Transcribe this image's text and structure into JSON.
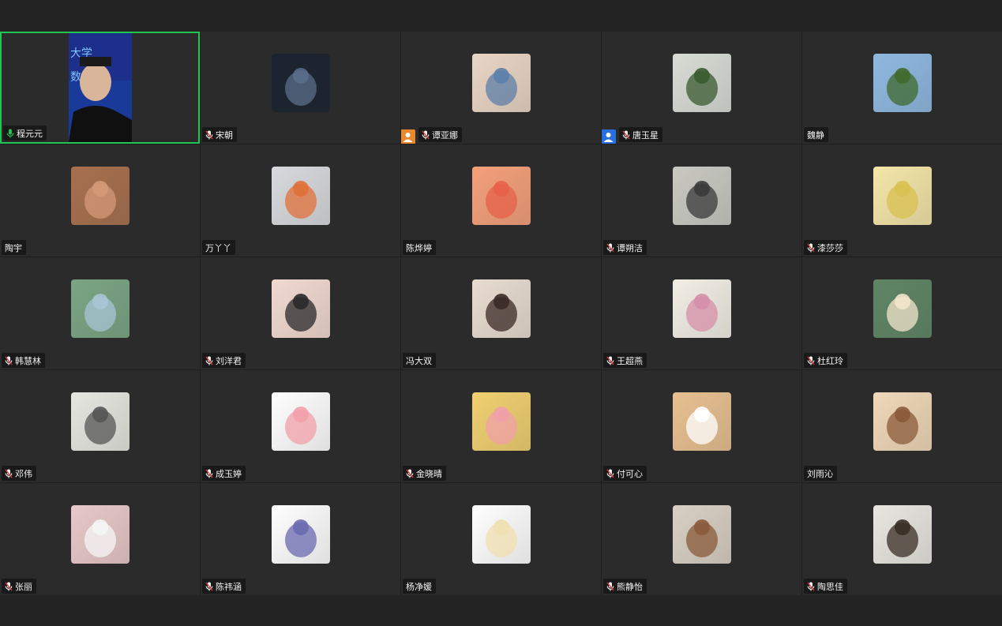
{
  "participants": [
    {
      "name": "程元元",
      "mic": "active",
      "role": null,
      "avatar": "video-feed",
      "active_speaker": true,
      "colors": [
        "#1a3a9a",
        "#f0e0c8"
      ]
    },
    {
      "name": "宋朝",
      "mic": "muted",
      "role": null,
      "avatar": "night-street-photo",
      "colors": [
        "#1b2330",
        "#5a6e8a"
      ]
    },
    {
      "name": "谭亚娜",
      "mic": "muted",
      "role": "host",
      "avatar": "family-photo",
      "colors": [
        "#e9d5c4",
        "#5d7fa8"
      ]
    },
    {
      "name": "唐玉星",
      "mic": "muted",
      "role": "cohost",
      "avatar": "child-photo",
      "colors": [
        "#d8dcd5",
        "#3a5a30"
      ]
    },
    {
      "name": "魏静",
      "mic": "none",
      "role": null,
      "avatar": "city-landscape-photo",
      "colors": [
        "#8fb8e0",
        "#3f6a2c"
      ]
    },
    {
      "name": "陶宇",
      "mic": "none",
      "role": null,
      "avatar": "girl-face-photo",
      "colors": [
        "#a7704e",
        "#d49a78"
      ]
    },
    {
      "name": "万丫丫",
      "mic": "none",
      "role": null,
      "avatar": "bunny-drawing",
      "colors": [
        "#d7d9dc",
        "#e0703a"
      ]
    },
    {
      "name": "陈烨婷",
      "mic": "none",
      "role": null,
      "avatar": "cartoon-bun",
      "colors": [
        "#f4a07a",
        "#e5604a"
      ]
    },
    {
      "name": "谭朔洁",
      "mic": "muted",
      "role": null,
      "avatar": "girl-sitting-photo",
      "colors": [
        "#c9c9c2",
        "#3a3a3a"
      ]
    },
    {
      "name": "漆莎莎",
      "mic": "muted",
      "role": null,
      "avatar": "cartoon-pikachu",
      "colors": [
        "#f4e6a8",
        "#d8c050"
      ]
    },
    {
      "name": "韩慧林",
      "mic": "muted",
      "role": null,
      "avatar": "anime-girl",
      "colors": [
        "#7aa584",
        "#a8c4d6"
      ]
    },
    {
      "name": "刘洋君",
      "mic": "muted",
      "role": null,
      "avatar": "girl-portrait-photo",
      "colors": [
        "#f1d9d0",
        "#2a2a2a"
      ]
    },
    {
      "name": "冯大双",
      "mic": "none",
      "role": null,
      "avatar": "girl-eating-photo",
      "colors": [
        "#e8dcd0",
        "#3a2a26"
      ]
    },
    {
      "name": "王超燕",
      "mic": "muted",
      "role": null,
      "avatar": "girl-hat-photo",
      "colors": [
        "#f2eee6",
        "#d58fa8"
      ]
    },
    {
      "name": "杜红玲",
      "mic": "muted",
      "role": null,
      "avatar": "cartoon-rabbit",
      "colors": [
        "#5f8565",
        "#f3e6cc"
      ]
    },
    {
      "name": "邓伟",
      "mic": "muted",
      "role": null,
      "avatar": "ink-painting",
      "colors": [
        "#e6e6e0",
        "#555555"
      ]
    },
    {
      "name": "成玉婷",
      "mic": "muted",
      "role": null,
      "avatar": "cartoon-pig",
      "colors": [
        "#ffffff",
        "#f2a0aa"
      ]
    },
    {
      "name": "金晓晴",
      "mic": "muted",
      "role": null,
      "avatar": "cartoon-loopy",
      "colors": [
        "#f0d070",
        "#f0a0a8"
      ]
    },
    {
      "name": "付可心",
      "mic": "muted",
      "role": null,
      "avatar": "corgi-photo",
      "colors": [
        "#e8c090",
        "#ffffff"
      ]
    },
    {
      "name": "刘雨沁",
      "mic": "none",
      "role": null,
      "avatar": "girl-bucket-hat-photo",
      "colors": [
        "#f0d8b8",
        "#8a5a3a"
      ]
    },
    {
      "name": "张丽",
      "mic": "muted",
      "role": null,
      "avatar": "cat-bunny-ears",
      "colors": [
        "#e8c8c8",
        "#f5f5f5"
      ]
    },
    {
      "name": "陈祎涵",
      "mic": "muted",
      "role": null,
      "avatar": "line-art-girl",
      "colors": [
        "#ffffff",
        "#6a6ab0"
      ]
    },
    {
      "name": "杨净媛",
      "mic": "none",
      "role": null,
      "avatar": "cartoon-sheep",
      "colors": [
        "#ffffff",
        "#f0e0b0"
      ]
    },
    {
      "name": "熊静怡",
      "mic": "muted",
      "role": null,
      "avatar": "teddy-bear-photo",
      "colors": [
        "#d8d0c4",
        "#8a5a3a"
      ]
    },
    {
      "name": "陶思佳",
      "mic": "muted",
      "role": null,
      "avatar": "cafe-window-photo",
      "colors": [
        "#e8e6e0",
        "#3a2e26"
      ]
    }
  ],
  "colors": {
    "active_speaker_border": "#23c552",
    "mic_active": "#23c552",
    "mic_muted": "#e23b3b",
    "host_badge": "#e8892c",
    "cohost_badge": "#2a6fe0"
  }
}
